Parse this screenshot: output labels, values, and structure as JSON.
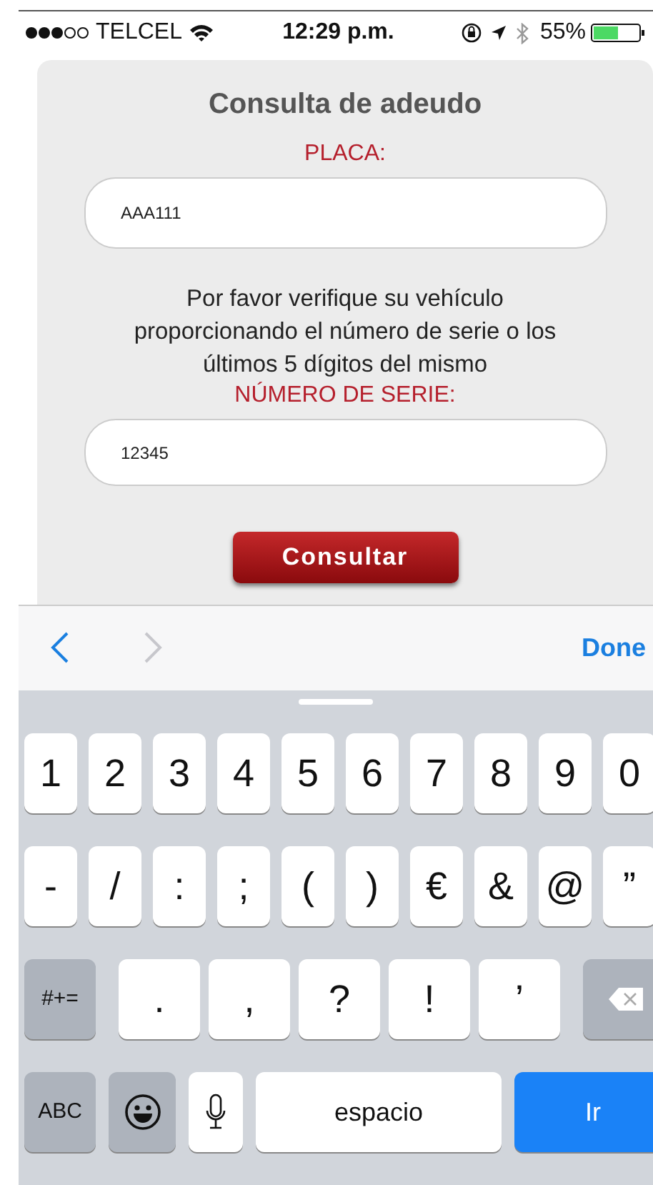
{
  "status_bar": {
    "carrier": "TELCEL",
    "time": "12:29 p.m.",
    "battery_percent": "55%"
  },
  "form": {
    "title": "Consulta de adeudo",
    "plate_label": "PLACA:",
    "plate_value": "AAA111",
    "message": "Por favor verifique su vehículo proporcionando el número de serie o los últimos 5 dígitos del mismo",
    "serial_label": "NÚMERO DE SERIE:",
    "serial_value": "12345",
    "submit_button": "Consultar"
  },
  "accessory_bar": {
    "previous": {
      "disabled": false
    },
    "next": {
      "disabled": true
    },
    "done": "Done"
  },
  "keyboard": {
    "number_row": [
      {
        "kind": "char",
        "label": "1"
      },
      {
        "kind": "char",
        "label": "2"
      },
      {
        "kind": "char",
        "label": "3"
      },
      {
        "kind": "char",
        "label": "4"
      },
      {
        "kind": "char",
        "label": "5"
      },
      {
        "kind": "char",
        "label": "6"
      },
      {
        "kind": "char",
        "label": "7"
      },
      {
        "kind": "char",
        "label": "8"
      },
      {
        "kind": "char",
        "label": "9"
      },
      {
        "kind": "char",
        "label": "0"
      }
    ],
    "symbol_row": [
      {
        "kind": "char",
        "label": "-"
      },
      {
        "kind": "char",
        "label": "/"
      },
      {
        "kind": "char",
        "label": ":"
      },
      {
        "kind": "char",
        "label": ";"
      },
      {
        "kind": "char",
        "label": "("
      },
      {
        "kind": "char",
        "label": ")"
      },
      {
        "kind": "char",
        "label": "€"
      },
      {
        "kind": "char",
        "label": "&"
      },
      {
        "kind": "char",
        "label": "@"
      },
      {
        "kind": "char",
        "label": "”"
      }
    ],
    "punctuation_row": [
      {
        "kind": "function",
        "label": "#+="
      },
      {
        "kind": "wide",
        "label": "."
      },
      {
        "kind": "wide",
        "label": ","
      },
      {
        "kind": "wide",
        "label": "?"
      },
      {
        "kind": "wide",
        "label": "!"
      },
      {
        "kind": "wide",
        "label": "’"
      },
      {
        "kind": "delete"
      }
    ],
    "bottom_row": [
      {
        "kind": "function",
        "label": "ABC"
      },
      {
        "kind": "emoji"
      },
      {
        "kind": "mic"
      },
      {
        "kind": "space",
        "label": "espacio"
      },
      {
        "kind": "go",
        "label": "Ir"
      }
    ]
  }
}
